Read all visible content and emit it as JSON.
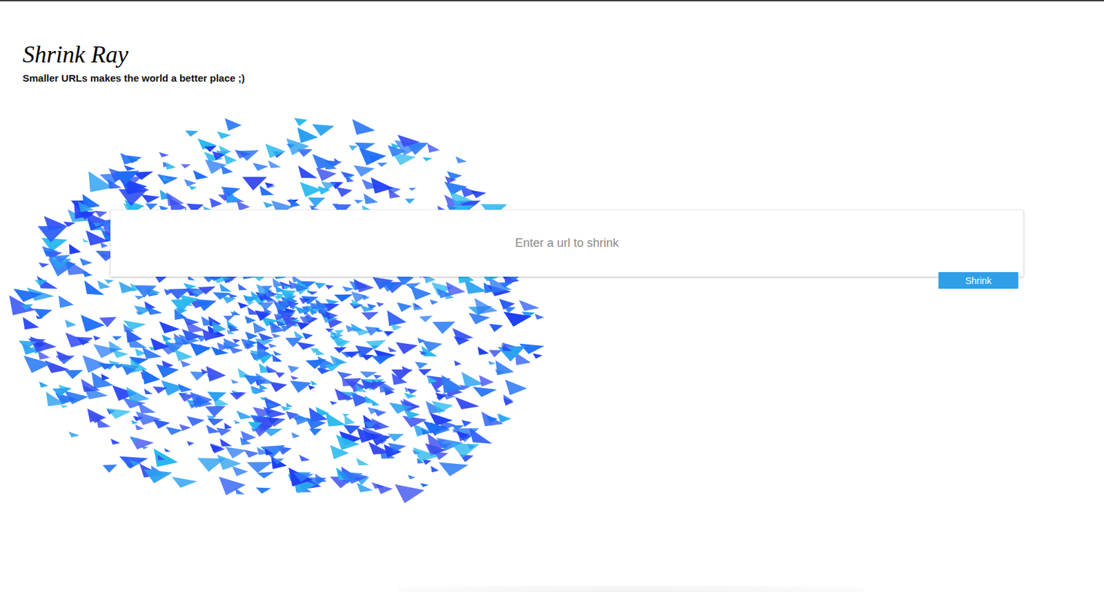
{
  "app": {
    "title": "Shrink Ray",
    "tagline": "Smaller URLs makes the world a better place ;)"
  },
  "form": {
    "placeholder": "Enter a url to shrink",
    "button": "Shrink"
  }
}
